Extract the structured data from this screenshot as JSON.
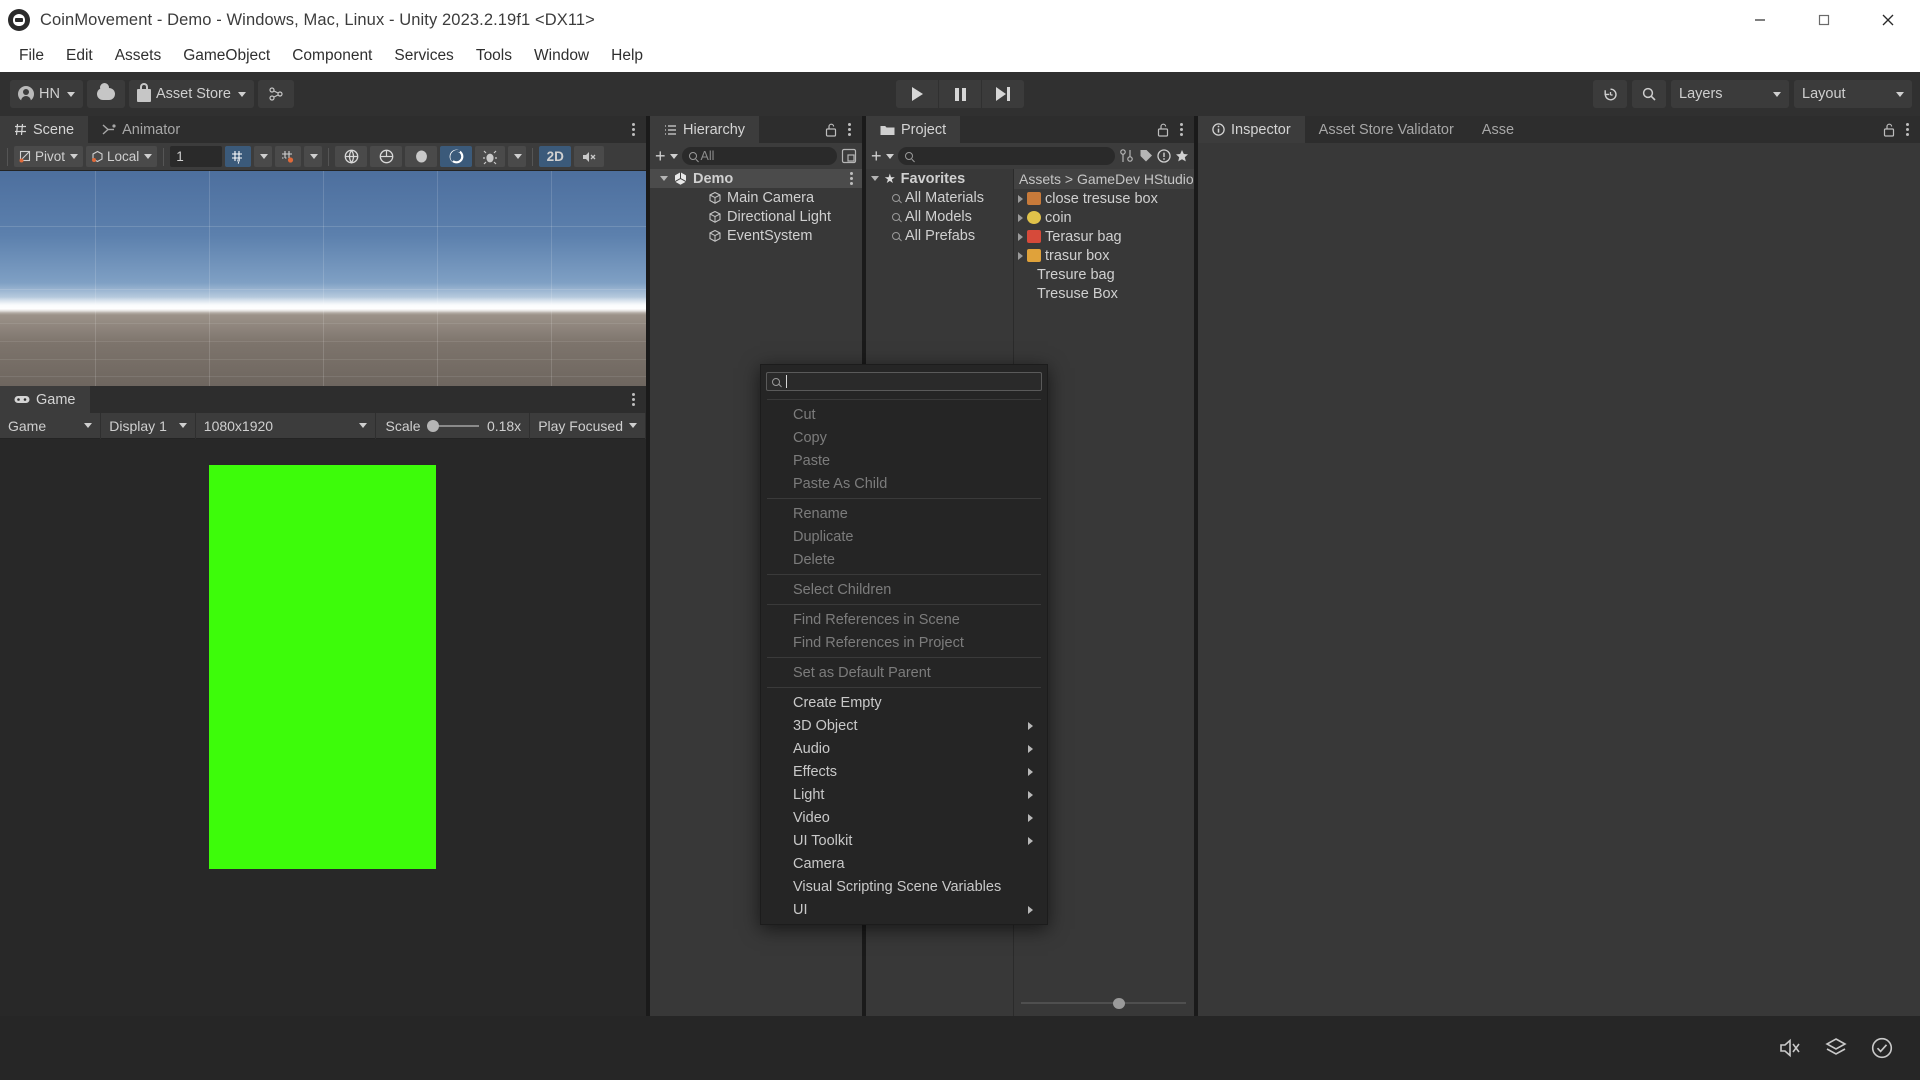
{
  "window": {
    "title": "CoinMovement - Demo - Windows, Mac, Linux - Unity 2023.2.19f1 <DX11>",
    "app_icon": "unity-logo-icon",
    "minimize": "minimize-icon",
    "maximize": "maximize-icon",
    "close": "close-icon"
  },
  "menubar": {
    "items": [
      "File",
      "Edit",
      "Assets",
      "GameObject",
      "Component",
      "Services",
      "Tools",
      "Window",
      "Help"
    ]
  },
  "toolbar": {
    "account_label": "HN",
    "cloud_label": "",
    "asset_store_label": "Asset Store",
    "collab_icon": "version-control-icon",
    "play": "play-icon",
    "pause": "pause-icon",
    "step": "step-icon",
    "undo_history": "undo-history-icon",
    "search": "search-icon",
    "layers_label": "Layers",
    "layout_label": "Layout"
  },
  "scene_panel": {
    "tabs": [
      {
        "label": "Scene",
        "icon": "scene-grid-icon",
        "active": true
      },
      {
        "label": "Animator",
        "icon": "animator-icon",
        "active": false
      }
    ],
    "toolbar": {
      "pivot_label": "Pivot",
      "local_label": "Local",
      "grid_value": "1",
      "grid_snap_icon": "grid-snap-y-icon",
      "snap_increment_icon": "snap-increment-icon",
      "shading_icon": "shading-mode-icon",
      "twod_label": "2D",
      "audio_icon": "scene-audio-icon",
      "fx_icon": "effects-icon",
      "lighting_icon": "lighting-icon",
      "gizmo_icon": "gizmo-icon"
    }
  },
  "game_panel": {
    "tab": {
      "label": "Game",
      "icon": "gamepad-icon"
    },
    "toolbar": {
      "mode_label": "Game",
      "display_label": "Display 1",
      "resolution_label": "1080x1920",
      "scale_label": "Scale",
      "scale_value": "0.18x",
      "focus_label": "Play Focused"
    },
    "content_color": "#3dfc0a"
  },
  "hierarchy": {
    "tab_label": "Hierarchy",
    "tab_icon": "hierarchy-list-icon",
    "lock_icon": "lock-open-icon",
    "search_placeholder": "All",
    "add_label": "+",
    "tree": [
      {
        "label": "Demo",
        "icon": "unity-scene-icon",
        "depth": 0,
        "expanded": true
      },
      {
        "label": "Main Camera",
        "icon": "gameobject-cube-icon",
        "depth": 1
      },
      {
        "label": "Directional Light",
        "icon": "gameobject-cube-icon",
        "depth": 1
      },
      {
        "label": "EventSystem",
        "icon": "gameobject-cube-icon",
        "depth": 1
      }
    ]
  },
  "project": {
    "tab_label": "Project",
    "tab_icon": "folder-icon",
    "lock_icon": "lock-open-icon",
    "search_placeholder": "",
    "favorites": {
      "label": "Favorites",
      "items": [
        "All Materials",
        "All Models",
        "All Prefabs"
      ]
    },
    "breadcrumb": "Assets > GameDev HStudio",
    "assets": [
      {
        "label": "close tresuse box",
        "color": "#c77a3a",
        "expandable": true
      },
      {
        "label": "coin",
        "color": "#e0c24a",
        "expandable": true
      },
      {
        "label": "Terasur bag",
        "color": "#d64a3a",
        "expandable": true
      },
      {
        "label": "trasur box",
        "color": "#e0a23a",
        "expandable": true
      },
      {
        "label": "Tresure bag",
        "color": "#888888",
        "expandable": false
      },
      {
        "label": "Tresuse Box",
        "color": "#888888",
        "expandable": false
      }
    ]
  },
  "inspector": {
    "tabs": [
      {
        "label": "Inspector",
        "icon": "info-icon",
        "active": true
      },
      {
        "label": "Asset Store Validator",
        "icon": "",
        "active": false
      },
      {
        "label": "Asse",
        "icon": "",
        "active": false
      }
    ],
    "lock_icon": "lock-open-icon"
  },
  "context_menu": {
    "search_value": "",
    "groups": [
      [
        {
          "label": "Cut",
          "enabled": false
        },
        {
          "label": "Copy",
          "enabled": false
        },
        {
          "label": "Paste",
          "enabled": false
        },
        {
          "label": "Paste As Child",
          "enabled": false
        }
      ],
      [
        {
          "label": "Rename",
          "enabled": false
        },
        {
          "label": "Duplicate",
          "enabled": false
        },
        {
          "label": "Delete",
          "enabled": false
        }
      ],
      [
        {
          "label": "Select Children",
          "enabled": false
        }
      ],
      [
        {
          "label": "Find References in Scene",
          "enabled": false
        },
        {
          "label": "Find References in Project",
          "enabled": false
        }
      ],
      [
        {
          "label": "Set as Default Parent",
          "enabled": false
        }
      ],
      [
        {
          "label": "Create Empty",
          "enabled": true,
          "submenu": false
        },
        {
          "label": "3D Object",
          "enabled": true,
          "submenu": true
        },
        {
          "label": "Audio",
          "enabled": true,
          "submenu": true
        },
        {
          "label": "Effects",
          "enabled": true,
          "submenu": true
        },
        {
          "label": "Light",
          "enabled": true,
          "submenu": true
        },
        {
          "label": "Video",
          "enabled": true,
          "submenu": true
        },
        {
          "label": "UI Toolkit",
          "enabled": true,
          "submenu": true
        },
        {
          "label": "Camera",
          "enabled": true,
          "submenu": false
        },
        {
          "label": "Visual Scripting Scene Variables",
          "enabled": true,
          "submenu": false
        },
        {
          "label": "UI",
          "enabled": true,
          "submenu": true
        }
      ]
    ]
  },
  "statusbar": {
    "icons": [
      "mute-audio-icon",
      "layers-status-icon",
      "check-circle-icon"
    ]
  }
}
